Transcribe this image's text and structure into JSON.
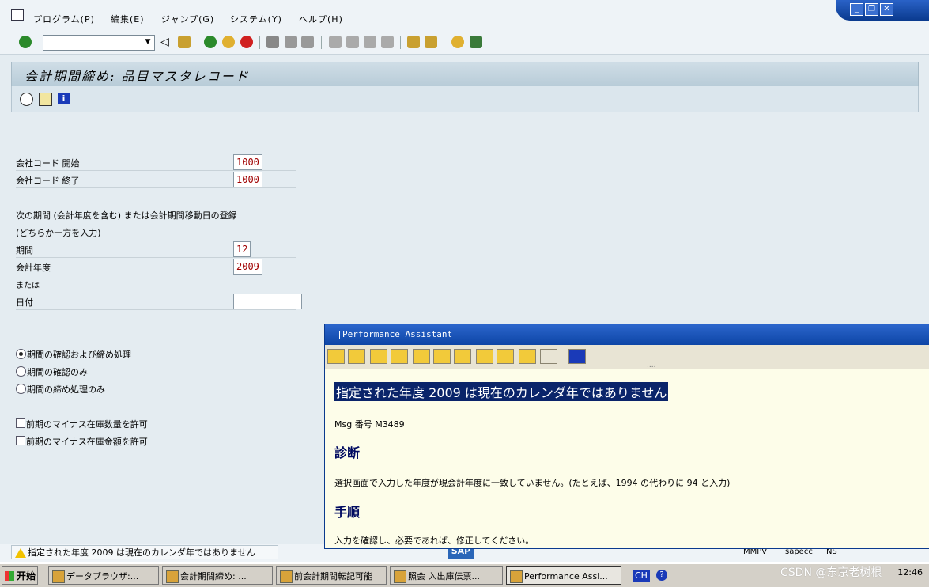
{
  "menu": {
    "items": [
      "プログラム(P)",
      "編集(E)",
      "ジャンプ(G)",
      "システム(Y)",
      "ヘルプ(H)"
    ]
  },
  "window_controls": {
    "minimize": "_",
    "restore": "❐",
    "close": "✕"
  },
  "toolbar": {
    "command_field_value": ""
  },
  "screen": {
    "title": "会計期間締め: 品目マスタレコード"
  },
  "form": {
    "company_code_from": {
      "label": "会社コード 開始",
      "value": "1000"
    },
    "company_code_to": {
      "label": "会社コード 終了",
      "value": "1000"
    },
    "section_note_1": "次の期間 (会計年度を含む) または会計期間移動日の登録",
    "section_note_2": "(どちらか一方を入力)",
    "period": {
      "label": "期間",
      "value": "12"
    },
    "fiscal_year": {
      "label": "会計年度",
      "value": "2009"
    },
    "or_label": "または",
    "date": {
      "label": "日付",
      "value": ""
    },
    "radio_options": [
      {
        "label": "期間の確認および締め処理",
        "selected": true
      },
      {
        "label": "期間の確認のみ",
        "selected": false
      },
      {
        "label": "期間の締め処理のみ",
        "selected": false
      }
    ],
    "checkboxes": [
      {
        "label": "前期のマイナス在庫数量を許可",
        "checked": false
      },
      {
        "label": "前期のマイナス在庫金額を許可",
        "checked": false
      }
    ]
  },
  "status": {
    "message": "指定された年度 2009 は現在のカレンダ年ではありません",
    "sap_logo": "SAP",
    "transaction": "MMPV",
    "server": "sapecc",
    "mode": "INS"
  },
  "assistant": {
    "title": "Performance Assistant",
    "handle": "....",
    "headline": "指定された年度 2009 は現在のカレンダ年ではありません",
    "msg_number": "Msg 番号 M3489",
    "diagnosis_heading": "診断",
    "diagnosis_text": "選択画面で入力した年度が現会計年度に一致していません。(たとえば、1994 の代わりに 94 と入力)",
    "procedure_heading": "手順",
    "procedure_text": "入力を確認し、必要であれば、修正してください。"
  },
  "taskbar": {
    "start": "开始",
    "tasks": [
      "データブラウザ:...",
      "会計期間締め: ...",
      "前会計期間転記可能",
      "照会 入出庫伝票...",
      "Performance Assi..."
    ],
    "lang": "CH",
    "clock": "12:46"
  },
  "watermark": "CSDN @东京老树根"
}
